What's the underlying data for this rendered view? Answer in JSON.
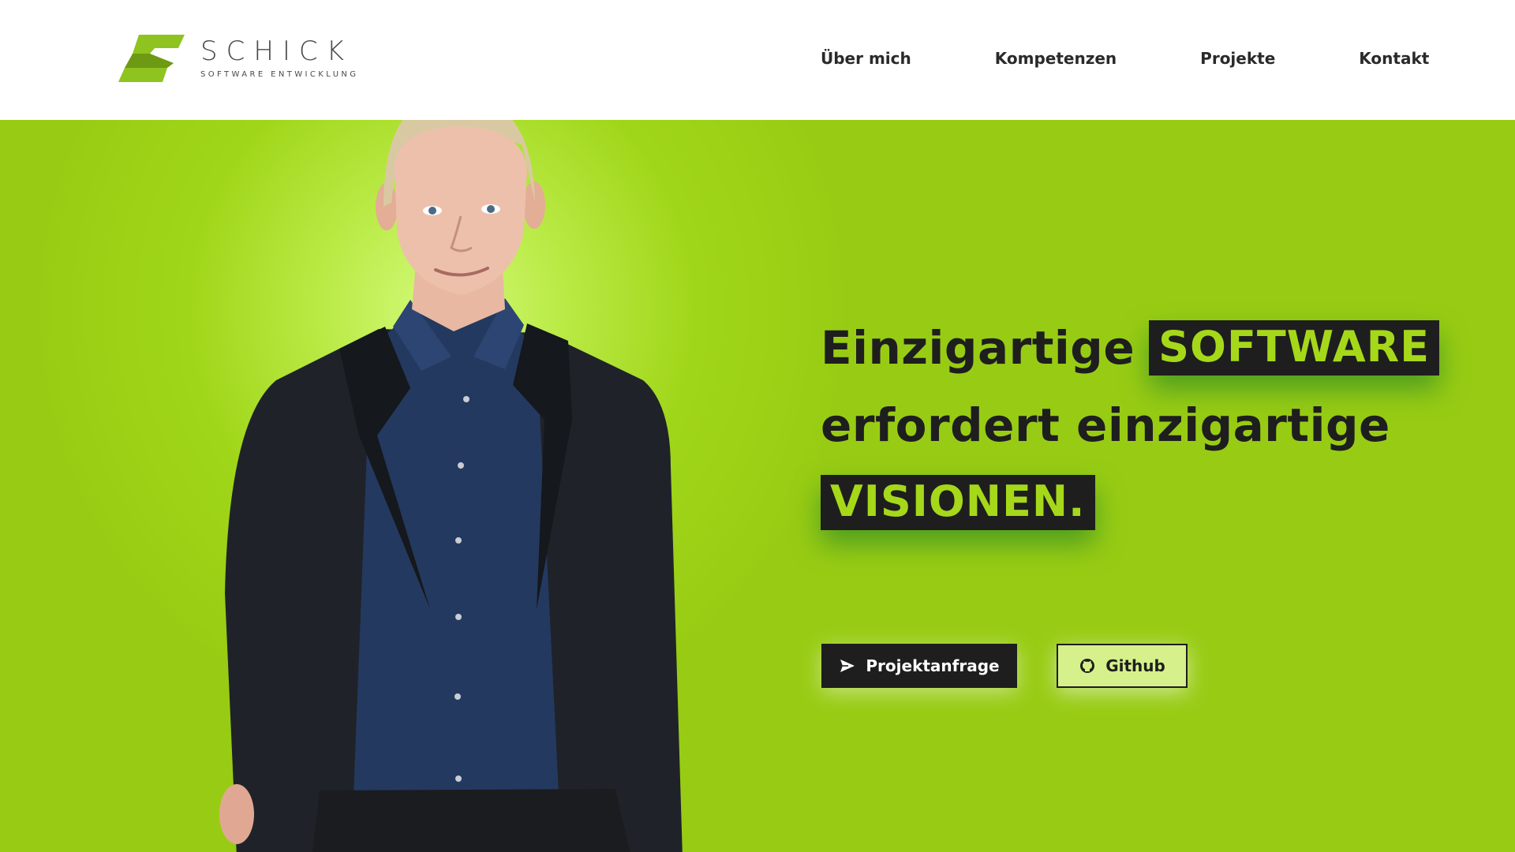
{
  "brand": {
    "name": "SCHICK",
    "tagline": "SOFTWARE ENTWICKLUNG",
    "logo_icon": "stylized-s-logo-icon",
    "color": "#8fc31f"
  },
  "nav": {
    "items": [
      {
        "label": "Über mich"
      },
      {
        "label": "Kompetenzen"
      },
      {
        "label": "Projekte"
      },
      {
        "label": "Kontakt"
      }
    ]
  },
  "hero": {
    "background_color": "#98cc14",
    "headline": {
      "line1_prefix": "Einzigartige",
      "line1_highlight": "SOFTWARE",
      "line2": "erfordert einzigartige",
      "line3_highlight": "VISIONEN."
    },
    "highlight_text_color": "#a6d81a",
    "highlight_background": "#1e1e1e",
    "buttons": {
      "primary": {
        "label": "Projektanfrage",
        "icon": "send-icon"
      },
      "secondary": {
        "label": "Github",
        "icon": "github-icon"
      }
    }
  }
}
